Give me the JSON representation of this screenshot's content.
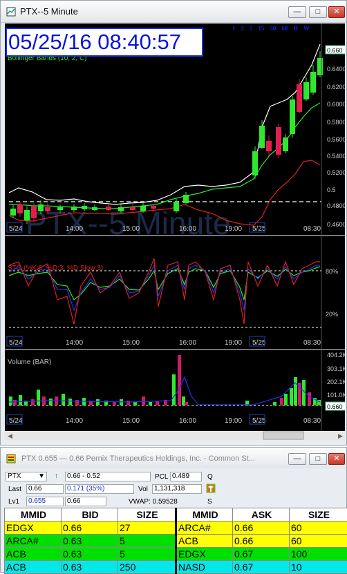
{
  "chart_window": {
    "title": "PTX--5 Minute",
    "min_label": "—",
    "max_label": "□",
    "close_label": "✕",
    "datetime": "05/25/16 08:40:57",
    "timeframes": [
      "◀",
      "▼",
      "1",
      "2",
      "5",
      "15",
      "30",
      "60",
      "D",
      "W",
      "▶"
    ],
    "watermark": "PTX--5 Minute",
    "price_panel": {
      "label": "Bollinger Bands (10, 2, C)",
      "y_ticks": [
        "0.660",
        "0.6400",
        "0.6200",
        "0.6000",
        "0.5800",
        "0.5600",
        "0.5400",
        "0.5200",
        "0.5",
        "0.4800",
        "0.4600"
      ],
      "x_ticks": [
        "5/24",
        "14:00",
        "15:00",
        "16:00",
        "19:00",
        "5/25",
        "08:30"
      ]
    },
    "sto_panel": {
      "label": "STO (%K:5, %D:3, %D Slow:3)",
      "y_ticks": [
        "80%",
        "20%"
      ],
      "x_ticks": [
        "5/24",
        "14:00",
        "15:00",
        "16:00",
        "19:00",
        "5/25",
        "08:30"
      ]
    },
    "volume_panel": {
      "label": "Volume (BAR)",
      "y_ticks": [
        "404.2K",
        "303.1K",
        "202.1K",
        "101.0K",
        "0.660"
      ],
      "x_ticks": [
        "5/24",
        "14:00",
        "15:00",
        "16:00",
        "19:00",
        "5/25",
        "08:30"
      ]
    }
  },
  "quote_window": {
    "title": "PTX   0.655 — 0.66   Pernix Therapeutics Holdings, Inc. - Common St...",
    "symbol": "PTX",
    "change": "0.66 - 0.52",
    "pcl_label": "PCL",
    "pcl": "0.489",
    "q_label": "Q",
    "last_label": "Last",
    "last": "0.66",
    "net_change": "0.171  (35%)",
    "vol_label": "Vol",
    "vol": "1,131,318",
    "lv1_label": "Lv1",
    "lv1_bid": "0.655",
    "lv1_ask": "0.66",
    "vwap": "VWAP: 0.59528",
    "s_label": "S",
    "headers": [
      "MMID",
      "BID",
      "SIZE",
      "MMID",
      "ASK",
      "SIZE"
    ],
    "rows": [
      {
        "bid_mmid": "EDGX",
        "bid": "0.66",
        "bid_size": "27",
        "ask_mmid": "ARCA#",
        "ask": "0.66",
        "ask_size": "60",
        "bid_color": "#ffff00",
        "ask_color": "#ffff00"
      },
      {
        "bid_mmid": "ARCA#",
        "bid": "0.63",
        "bid_size": "5",
        "ask_mmid": "ACB",
        "ask": "0.66",
        "ask_size": "60",
        "bid_color": "#00e000",
        "ask_color": "#ffff00"
      },
      {
        "bid_mmid": "ACB",
        "bid": "0.63",
        "bid_size": "5",
        "ask_mmid": "EDGX",
        "ask": "0.67",
        "ask_size": "100",
        "bid_color": "#00e000",
        "ask_color": "#00e000"
      },
      {
        "bid_mmid": "ACB",
        "bid": "0.63",
        "bid_size": "250",
        "ask_mmid": "NASD",
        "ask": "0.67",
        "ask_size": "10",
        "bid_color": "#00e8e8",
        "ask_color": "#00e8e8"
      }
    ]
  },
  "chart_data": [
    {
      "type": "line",
      "title": "Bollinger Bands (10, 2, C)",
      "x": [
        "5/24",
        "14:00",
        "15:00",
        "16:00",
        "19:00",
        "5/25",
        "08:30"
      ],
      "ylim": [
        0.45,
        0.67
      ],
      "series": [
        {
          "values": [
            0.49,
            0.487,
            0.49,
            0.488,
            0.489,
            0.492,
            0.52,
            0.575,
            0.62,
            0.66
          ]
        }
      ]
    },
    {
      "type": "line",
      "title": "STO (%K:5, %D:3, %D Slow:3)",
      "ylim": [
        0,
        100
      ],
      "series": [
        {
          "values": [
            80,
            40,
            70,
            15,
            85,
            60,
            20,
            80,
            30,
            85,
            20,
            80,
            85
          ]
        }
      ]
    },
    {
      "type": "bar",
      "title": "Volume (BAR)",
      "ylim": [
        0,
        404200
      ],
      "values": [
        40000,
        35000,
        60000,
        30000,
        25000,
        45000,
        20000,
        15000,
        30000,
        20000,
        300000,
        35000,
        25000,
        25000,
        20000,
        20000,
        60000,
        120000,
        80000,
        50000,
        30000
      ]
    }
  ]
}
